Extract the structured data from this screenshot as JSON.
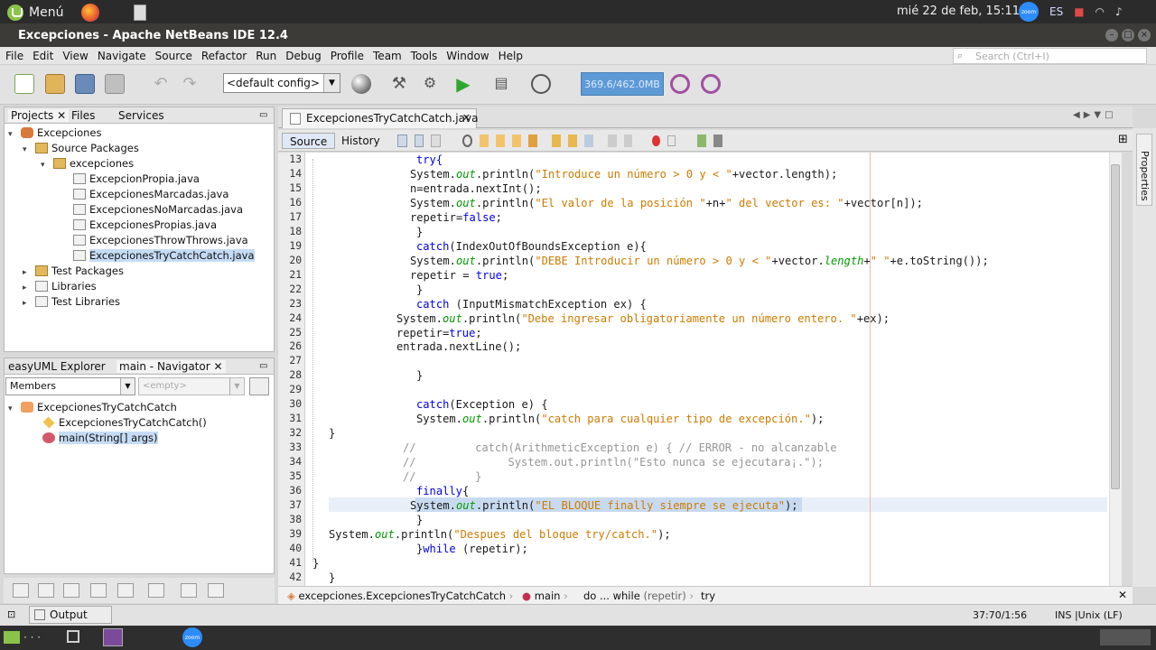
{
  "system": {
    "menu_label": "Menú",
    "clock": "mié 22 de feb, 15:11",
    "zoom_label": "zoom",
    "lang": "ES"
  },
  "window": {
    "title": "Excepciones - Apache NetBeans IDE 12.4"
  },
  "menubar": [
    "File",
    "Edit",
    "View",
    "Navigate",
    "Source",
    "Refactor",
    "Run",
    "Debug",
    "Profile",
    "Team",
    "Tools",
    "Window",
    "Help"
  ],
  "search": {
    "placeholder": "Search (Ctrl+I)"
  },
  "toolbar": {
    "config": "<default config>",
    "memory": "369.6/462.0MB"
  },
  "projects_pane": {
    "tabs": [
      "Projects",
      "Files",
      "Services"
    ],
    "tree": {
      "project": "Excepciones",
      "source_packages": "Source Packages",
      "package": "excepciones",
      "files": [
        "ExcepcionPropia.java",
        "ExcepcionesMarcadas.java",
        "ExcepcionesNoMarcadas.java",
        "ExcepcionesPropias.java",
        "ExcepcionesThrowThrows.java",
        "ExcepcionesTryCatchCatch.java"
      ],
      "test_packages": "Test Packages",
      "libraries": "Libraries",
      "test_libraries": "Test Libraries"
    }
  },
  "navigator_pane": {
    "tabs": [
      "easyUML Explorer",
      "main - Navigator"
    ],
    "filter": "Members",
    "filter2": "<empty>",
    "class": "ExcepcionesTryCatchCatch",
    "members": [
      "ExcepcionesTryCatchCatch()",
      "main(String[] args)"
    ]
  },
  "editor": {
    "tab": "ExcepcionesTryCatchCatch.java",
    "modes": [
      "Source",
      "History"
    ],
    "lines": [
      {
        "n": "13",
        "i": 1,
        "parts": [
          [
            "try{",
            "kw"
          ]
        ]
      },
      {
        "n": "14",
        "i": 2,
        "parts": [
          [
            "System.",
            ""
          ],
          [
            "out",
            "fd"
          ],
          [
            ".println(",
            ""
          ],
          [
            "\"Introduce un número > 0 y < \"",
            "st"
          ],
          [
            "+vector.length);",
            ""
          ]
        ]
      },
      {
        "n": "15",
        "i": 2,
        "parts": [
          [
            "n=entrada.nextInt();",
            ""
          ]
        ]
      },
      {
        "n": "16",
        "i": 2,
        "parts": [
          [
            "System.",
            ""
          ],
          [
            "out",
            "fd"
          ],
          [
            ".println(",
            ""
          ],
          [
            "\"El valor de la posición \"",
            "st"
          ],
          [
            "+n+",
            ""
          ],
          [
            "\" del vector es: \"",
            "st"
          ],
          [
            "+vector[n]);",
            ""
          ]
        ]
      },
      {
        "n": "17",
        "i": 2,
        "parts": [
          [
            "repetir=",
            ""
          ],
          [
            "false",
            "kw"
          ],
          [
            ";",
            ""
          ]
        ]
      },
      {
        "n": "18",
        "i": 1,
        "parts": [
          [
            "}",
            ""
          ]
        ]
      },
      {
        "n": "19",
        "i": 1,
        "parts": [
          [
            "catch",
            "kw"
          ],
          [
            "(IndexOutOfBoundsException e){",
            ""
          ]
        ]
      },
      {
        "n": "20",
        "i": 2,
        "parts": [
          [
            "System.",
            ""
          ],
          [
            "out",
            "fd"
          ],
          [
            ".println(",
            ""
          ],
          [
            "\"DEBE Introducir un número > 0 y < \"",
            "st"
          ],
          [
            "+vector.",
            ""
          ],
          [
            "length",
            "fd"
          ],
          [
            "+",
            ""
          ],
          [
            "\" \"",
            "st"
          ],
          [
            "+e.toString());",
            ""
          ]
        ]
      },
      {
        "n": "21",
        "i": 2,
        "parts": [
          [
            "repetir = ",
            ""
          ],
          [
            "true",
            "kw"
          ],
          [
            ";",
            ""
          ]
        ]
      },
      {
        "n": "22",
        "i": 1,
        "parts": [
          [
            "}",
            ""
          ]
        ]
      },
      {
        "n": "23",
        "i": 1,
        "parts": [
          [
            "catch",
            "kw"
          ],
          [
            " (InputMismatchException ex) {",
            ""
          ]
        ]
      },
      {
        "n": "24",
        "i": 3,
        "parts": [
          [
            "System.",
            ""
          ],
          [
            "out",
            "fd"
          ],
          [
            ".println(",
            ""
          ],
          [
            "\"Debe ingresar obligatoriamente un número entero. \"",
            "st"
          ],
          [
            "+ex);",
            ""
          ]
        ]
      },
      {
        "n": "25",
        "i": 3,
        "parts": [
          [
            "repetir=",
            ""
          ],
          [
            "true",
            "kw"
          ],
          [
            ";",
            ""
          ]
        ]
      },
      {
        "n": "26",
        "i": 3,
        "parts": [
          [
            "entrada.nextLine();",
            ""
          ]
        ]
      },
      {
        "n": "27",
        "i": 0,
        "parts": []
      },
      {
        "n": "28",
        "i": 1,
        "parts": [
          [
            "}",
            ""
          ]
        ]
      },
      {
        "n": "29",
        "i": 0,
        "parts": []
      },
      {
        "n": "30",
        "i": 1,
        "parts": [
          [
            "catch",
            "kw"
          ],
          [
            "(Exception e) {",
            ""
          ]
        ]
      },
      {
        "n": "31",
        "i": 1,
        "parts": [
          [
            "System.",
            ""
          ],
          [
            "out",
            "fd"
          ],
          [
            ".println(",
            ""
          ],
          [
            "\"catch para cualquier tipo de excepción.\"",
            "st"
          ],
          [
            ");",
            ""
          ]
        ]
      },
      {
        "n": "32",
        "i": 4,
        "parts": [
          [
            "}",
            ""
          ]
        ]
      },
      {
        "n": "33",
        "i": 5,
        "parts": [
          [
            "//         catch(ArithmeticException e) { // ERROR - no alcanzable",
            "cm"
          ]
        ]
      },
      {
        "n": "34",
        "i": 5,
        "parts": [
          [
            "//              System.out.println(\"Esto nunca se ejecutara¡.\");",
            "cm"
          ]
        ]
      },
      {
        "n": "35",
        "i": 5,
        "parts": [
          [
            "//         }",
            "cm"
          ]
        ]
      },
      {
        "n": "36",
        "i": 1,
        "parts": [
          [
            "finally",
            "kw"
          ],
          [
            "{",
            ""
          ]
        ]
      },
      {
        "n": "37",
        "i": 2,
        "parts": [
          [
            "System.",
            ""
          ],
          [
            "out",
            "fd"
          ],
          [
            ".println(",
            ""
          ],
          [
            "\"EL BLOQUE finally siempre se ejecuta\"",
            "st"
          ],
          [
            ");",
            ""
          ]
        ]
      },
      {
        "n": "38",
        "i": 1,
        "parts": [
          [
            "}",
            ""
          ]
        ]
      },
      {
        "n": "39",
        "i": 4,
        "parts": [
          [
            "System.",
            ""
          ],
          [
            "out",
            "fd"
          ],
          [
            ".println(",
            ""
          ],
          [
            "\"Despues del bloque try/catch.\"",
            "st"
          ],
          [
            ");",
            ""
          ]
        ]
      },
      {
        "n": "40",
        "i": 1,
        "parts": [
          [
            "}",
            ""
          ],
          [
            "while",
            "kw"
          ],
          [
            " (repetir);",
            ""
          ]
        ]
      },
      {
        "n": "41",
        "i": 6,
        "parts": [
          [
            "}",
            ""
          ]
        ]
      },
      {
        "n": "42",
        "i": 7,
        "parts": [
          [
            "}",
            ""
          ]
        ]
      }
    ],
    "breadcrumbs": [
      "excepciones.ExcepcionesTryCatchCatch",
      "main",
      "do ... while",
      "(repetir)",
      "try"
    ]
  },
  "status": {
    "output": "Output",
    "position": "37:70/1:56",
    "mode": "INS",
    "eol": "Unix (LF)"
  },
  "colors": {
    "keyword": "#0000e6",
    "string": "#ce7b00",
    "field": "#009900",
    "comment": "#969696",
    "memory_bar": "#5d9ad5"
  }
}
